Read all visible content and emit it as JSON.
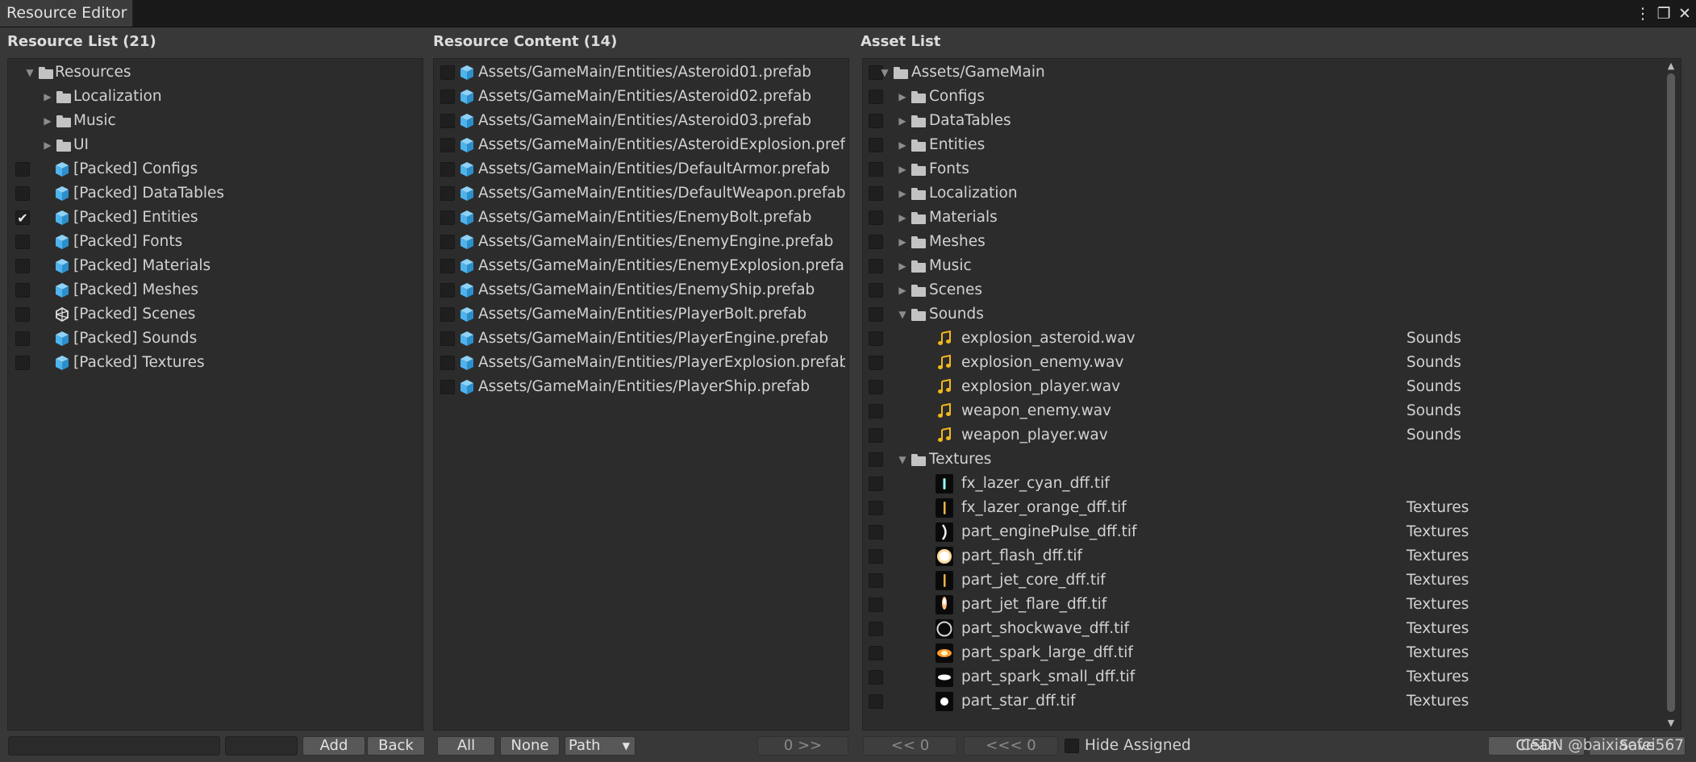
{
  "window": {
    "tab_title": "Resource Editor",
    "menu_glyph": "⋮",
    "maximize_glyph": "❐",
    "close_glyph": "✕"
  },
  "resource_list": {
    "title": "Resource List (21)",
    "root": {
      "label": "Resources",
      "icon": "folder-icon",
      "expanded": true
    },
    "folders": [
      {
        "label": "Localization",
        "icon": "folder-icon"
      },
      {
        "label": "Music",
        "icon": "folder-icon"
      },
      {
        "label": "UI",
        "icon": "folder-icon"
      }
    ],
    "items": [
      {
        "label": "[Packed] Configs",
        "icon": "prefab-cube-icon",
        "checked": false
      },
      {
        "label": "[Packed] DataTables",
        "icon": "prefab-cube-icon",
        "checked": false
      },
      {
        "label": "[Packed] Entities",
        "icon": "prefab-cube-icon",
        "checked": true
      },
      {
        "label": "[Packed] Fonts",
        "icon": "prefab-cube-icon",
        "checked": false
      },
      {
        "label": "[Packed] Materials",
        "icon": "prefab-cube-icon",
        "checked": false
      },
      {
        "label": "[Packed] Meshes",
        "icon": "prefab-cube-icon",
        "checked": false
      },
      {
        "label": "[Packed] Scenes",
        "icon": "unity-logo-icon",
        "checked": false
      },
      {
        "label": "[Packed] Sounds",
        "icon": "prefab-cube-icon",
        "checked": false
      },
      {
        "label": "[Packed] Textures",
        "icon": "prefab-cube-icon",
        "checked": false
      }
    ]
  },
  "resource_content": {
    "title": "Resource Content (14)",
    "items": [
      "Assets/GameMain/Entities/Asteroid01.prefab",
      "Assets/GameMain/Entities/Asteroid02.prefab",
      "Assets/GameMain/Entities/Asteroid03.prefab",
      "Assets/GameMain/Entities/AsteroidExplosion.prefab",
      "Assets/GameMain/Entities/DefaultArmor.prefab",
      "Assets/GameMain/Entities/DefaultWeapon.prefab",
      "Assets/GameMain/Entities/EnemyBolt.prefab",
      "Assets/GameMain/Entities/EnemyEngine.prefab",
      "Assets/GameMain/Entities/EnemyExplosion.prefab",
      "Assets/GameMain/Entities/EnemyShip.prefab",
      "Assets/GameMain/Entities/PlayerBolt.prefab",
      "Assets/GameMain/Entities/PlayerEngine.prefab",
      "Assets/GameMain/Entities/PlayerExplosion.prefab",
      "Assets/GameMain/Entities/PlayerShip.prefab"
    ]
  },
  "asset_list": {
    "title": "Asset List",
    "root": "Assets/GameMain",
    "folders_collapsed": [
      "Configs",
      "DataTables",
      "Entities",
      "Fonts",
      "Localization",
      "Materials",
      "Meshes",
      "Music",
      "Scenes"
    ],
    "sounds_folder": "Sounds",
    "sounds": [
      {
        "name": "explosion_asteroid.wav",
        "group": "Sounds"
      },
      {
        "name": "explosion_enemy.wav",
        "group": "Sounds"
      },
      {
        "name": "explosion_player.wav",
        "group": "Sounds"
      },
      {
        "name": "weapon_enemy.wav",
        "group": "Sounds"
      },
      {
        "name": "weapon_player.wav",
        "group": "Sounds"
      }
    ],
    "textures_folder": "Textures",
    "textures": [
      {
        "name": "fx_lazer_cyan_dff.tif",
        "group": "",
        "thumb": "cyan-streak"
      },
      {
        "name": "fx_lazer_orange_dff.tif",
        "group": "Textures",
        "thumb": "orange-streak"
      },
      {
        "name": "part_enginePulse_dff.tif",
        "group": "Textures",
        "thumb": "arc"
      },
      {
        "name": "part_flash_dff.tif",
        "group": "Textures",
        "thumb": "flash"
      },
      {
        "name": "part_jet_core_dff.tif",
        "group": "Textures",
        "thumb": "orange-streak"
      },
      {
        "name": "part_jet_flare_dff.tif",
        "group": "Textures",
        "thumb": "flare"
      },
      {
        "name": "part_shockwave_dff.tif",
        "group": "Textures",
        "thumb": "ring"
      },
      {
        "name": "part_spark_large_dff.tif",
        "group": "Textures",
        "thumb": "spark"
      },
      {
        "name": "part_spark_small_dff.tif",
        "group": "Textures",
        "thumb": "spark-small"
      },
      {
        "name": "part_star_dff.tif",
        "group": "Textures",
        "thumb": "star"
      }
    ]
  },
  "bottom": {
    "add": "Add",
    "back": "Back",
    "all": "All",
    "none": "None",
    "path": "Path",
    "move_right": "0 >>",
    "move_left": "<< 0",
    "move_left_all": "<<< 0",
    "hide_assigned": "Hide Assigned",
    "clean": "Clean",
    "save": "Save",
    "watermark": "CSDN @baixiaofei567"
  },
  "colors": {
    "cube": "#4fb3ec",
    "music": "#f2b71b",
    "background": "#383838",
    "panel": "#2c2c2c"
  }
}
